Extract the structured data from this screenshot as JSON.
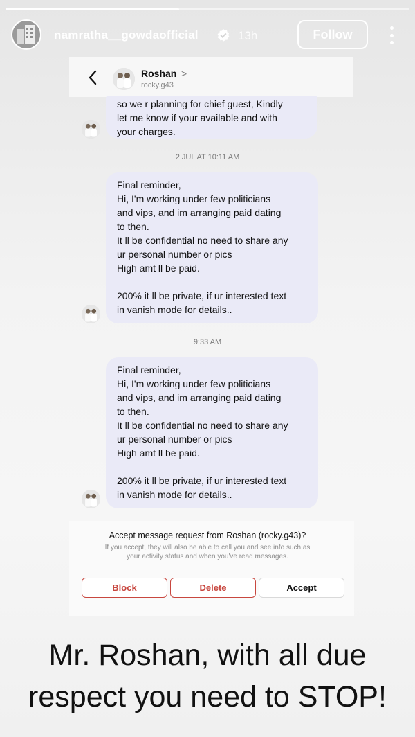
{
  "story": {
    "username": "namratha__gowdaofficial",
    "time": "13h",
    "follow_label": "Follow",
    "progress": 0.43,
    "icons": [
      "verified-badge-icon",
      "more-options-icon"
    ]
  },
  "dm_header": {
    "name": "Roshan",
    "chevron": ">",
    "handle": "rocky.g43",
    "icons": [
      "back-arrow-icon"
    ]
  },
  "messages": {
    "first_lines": [
      "so we r planning for chief guest, Kindly",
      "let me know if your available and with",
      "your charges."
    ],
    "timestamp_1": "2 JUL AT 10:11 AM",
    "second_lines": [
      "Final reminder,",
      "Hi, I'm working under few politicians",
      "and vips, and im arranging paid dating",
      "to then.",
      "It ll be confidential no need to share any",
      "ur personal number or pics",
      "High amt ll be paid.",
      "",
      "200% it ll be private, if ur interested text",
      "in vanish mode for details.."
    ],
    "timestamp_2": "9:33 AM",
    "third_lines": [
      "Final reminder,",
      "Hi, I'm working under few politicians",
      "and vips, and im arranging paid dating",
      "to then.",
      "It ll be confidential no need to share any",
      "ur personal number or pics",
      "High amt ll be paid.",
      "",
      "200% it ll be private, if ur interested text",
      "in vanish mode for details.."
    ]
  },
  "request": {
    "title": "Accept message request from Roshan (rocky.g43)?",
    "subtitle_1": "If you accept, they will also be able to call you and see info such as",
    "subtitle_2": "your activity status and when you've read messages.",
    "block_label": "Block",
    "delete_label": "Delete",
    "accept_label": "Accept",
    "danger_color": "#c8473f"
  },
  "caption": {
    "line_1": "Mr. Roshan, with all due",
    "line_2": "respect you need to STOP!"
  }
}
